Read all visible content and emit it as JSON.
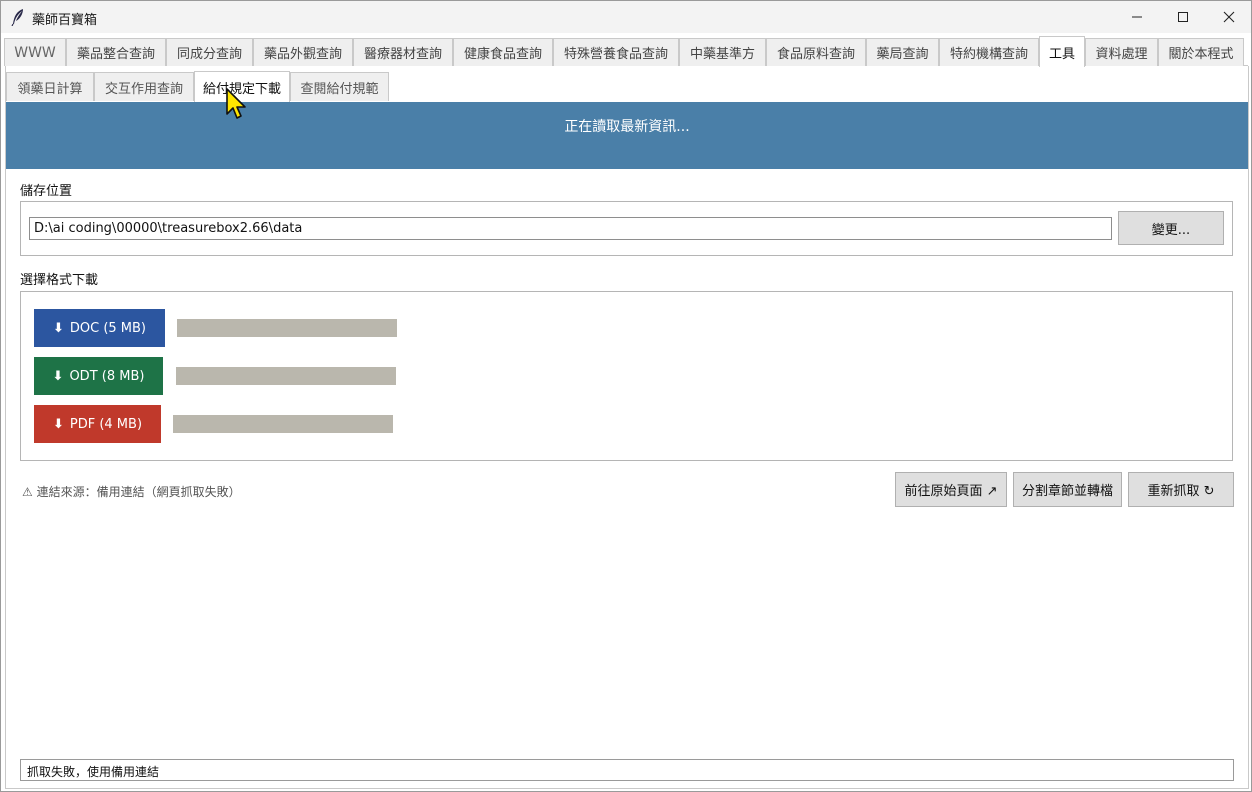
{
  "window": {
    "title": "藥師百寶箱"
  },
  "main_tabs": [
    "WWW",
    "藥品整合查詢",
    "同成分查詢",
    "藥品外觀查詢",
    "醫療器材查詢",
    "健康食品查詢",
    "特殊營養食品查詢",
    "中藥基準方",
    "食品原料查詢",
    "藥局查詢",
    "特約機構查詢",
    "工具",
    "資料處理",
    "關於本程式"
  ],
  "active_main_tab": "工具",
  "sub_tabs": [
    "領藥日計算",
    "交互作用查詢",
    "給付規定下載",
    "查閱給付規範"
  ],
  "active_sub_tab": "給付規定下載",
  "banner": {
    "text": "正在讀取最新資訊..."
  },
  "storage": {
    "label": "儲存位置",
    "path": "D:\\ai coding\\00000\\treasurebox2.66\\data",
    "change_button": "變更..."
  },
  "download": {
    "label": "選擇格式下載",
    "items": [
      {
        "label": "DOC  (5 MB)",
        "color": "#2c56a0",
        "progress": 0
      },
      {
        "label": "ODT  (8 MB)",
        "color": "#1e7347",
        "progress": 0
      },
      {
        "label": "PDF  (4 MB)",
        "color": "#c0392b",
        "progress": 0
      }
    ]
  },
  "note": "⚠ 連結來源：備用連結（網頁抓取失敗）",
  "actions": {
    "goto_original": "前往原始頁面 ↗",
    "split_convert": "分割章節並轉檔",
    "refetch": "重新抓取 ↻"
  },
  "status": "抓取失敗，使用備用連結",
  "icons": [
    "feather-icon",
    "minimize-icon",
    "maximize-icon",
    "close-icon",
    "download-arrow-icon",
    "cursor-pointer-icon"
  ]
}
